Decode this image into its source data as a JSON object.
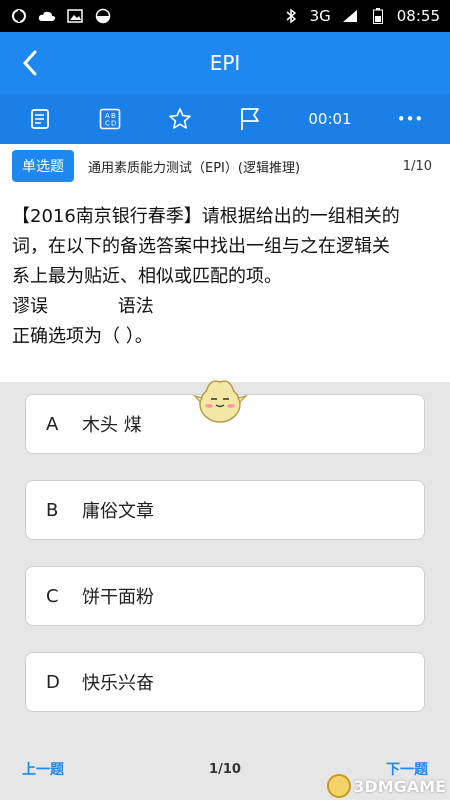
{
  "status_bar": {
    "network": "3G",
    "time": "08:55"
  },
  "title_bar": {
    "title": "EPI"
  },
  "toolbar": {
    "answer_card_icon": "answer-sheet-icon",
    "options_icon": "abcd-grid-icon",
    "favorite_icon": "star-icon",
    "report_icon": "flag-icon",
    "timer": "00:01",
    "more_label": "•••"
  },
  "question": {
    "type_label": "单选题",
    "source": "通用素质能力测试（EPI）(逻辑推理)",
    "counter": "1/10",
    "lines": [
      "【2016南京银行春季】请根据给出的一组相关的",
      "词，在以下的备选答案中找出一组与之在逻辑关",
      "系上最为贴近、相似或匹配的项。"
    ],
    "word1": "谬误",
    "word2": "语法",
    "prompt": "正确选项为（    ）。"
  },
  "options": [
    {
      "letter": "A",
      "text": "木头 煤"
    },
    {
      "letter": "B",
      "text": "庸俗文章"
    },
    {
      "letter": "C",
      "text": "饼干面粉"
    },
    {
      "letter": "D",
      "text": "快乐兴奋"
    }
  ],
  "bottom_bar": {
    "prev_label": "上一题",
    "page_indicator": "1/10",
    "next_label": "下一题"
  },
  "watermark": {
    "text": "3DMGAME"
  },
  "colors": {
    "primary": "#1e88f0",
    "toolbar": "#1b7fe8",
    "background": "#e6e6e6"
  }
}
